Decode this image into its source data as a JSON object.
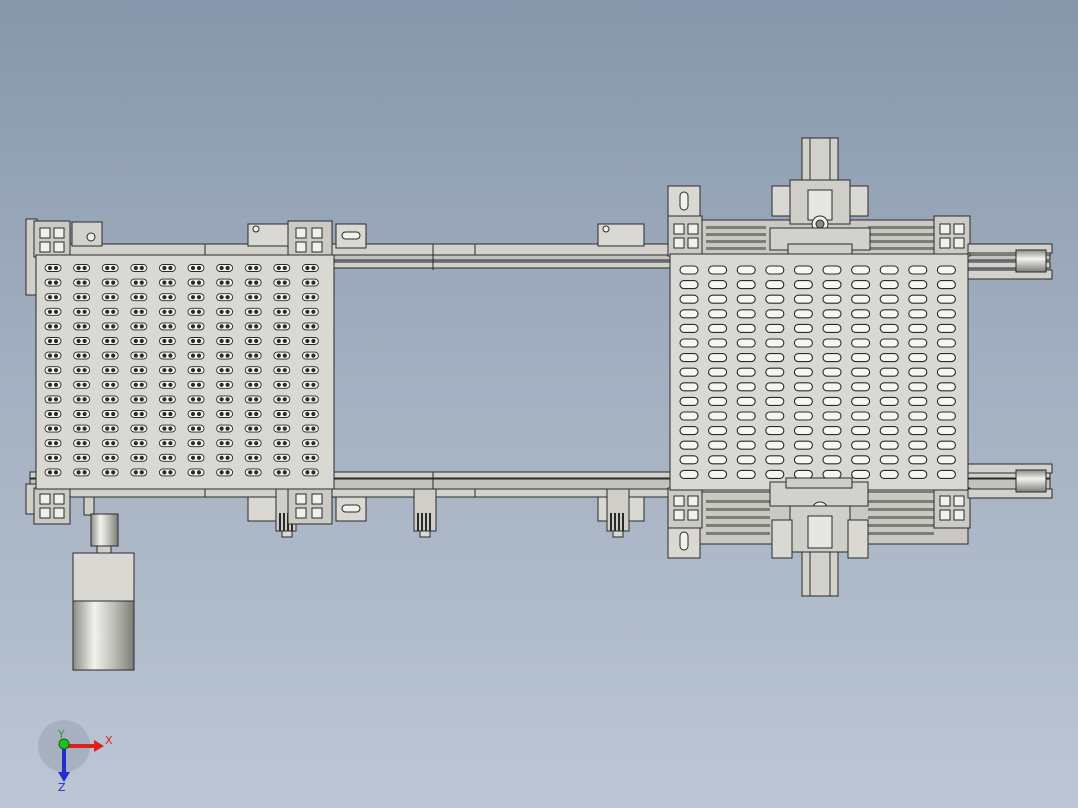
{
  "model": {
    "left_plate": {
      "rows": 15,
      "cols": 10,
      "pattern": "double-slot"
    },
    "right_plate": {
      "rows": 15,
      "cols": 10,
      "pattern": "oval-slot"
    }
  },
  "triad": {
    "x_label": "X",
    "y_label": "Y",
    "z_label": "Z",
    "x_color": "#e02020",
    "y_color": "#20c020",
    "z_color": "#2030d0"
  },
  "colors": {
    "metal": "#d9d8d2",
    "metal_dark": "#bcbbb5",
    "edge": "#2a2a2a"
  }
}
